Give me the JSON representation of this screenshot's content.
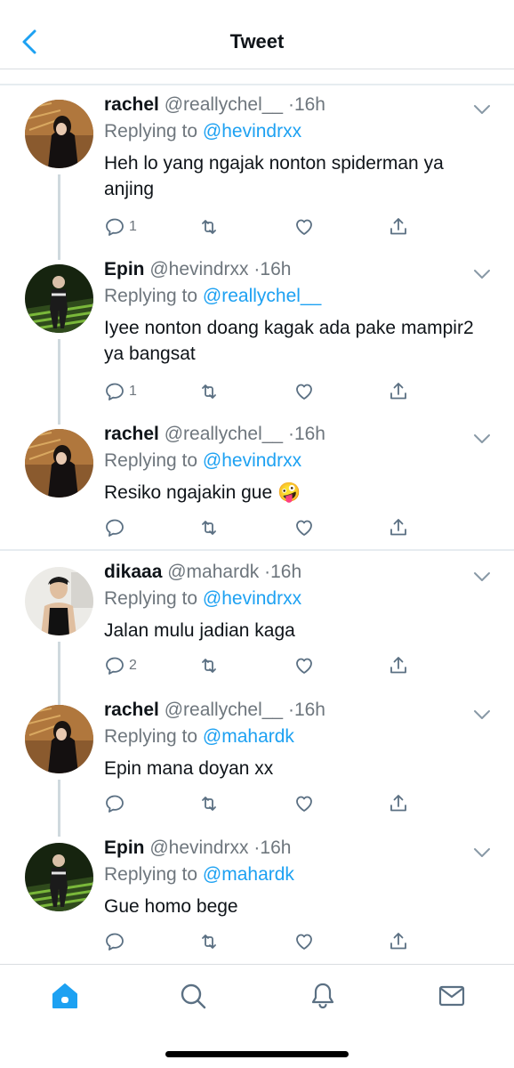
{
  "header": {
    "title": "Tweet"
  },
  "tweets": [
    {
      "name": "rachel",
      "handle": "@reallychel__",
      "dot": "·",
      "time": "16h",
      "replying_label": "Replying to",
      "replying_to": "@hevindrxx",
      "text": "Heh lo yang ngajak nonton spiderman ya anjing",
      "reply_count": "1",
      "avatar": "rachel"
    },
    {
      "name": "Epin",
      "handle": "@hevindrxx",
      "dot": "·",
      "time": "16h",
      "replying_label": "Replying to",
      "replying_to": "@reallychel__",
      "text": "Iyee nonton doang kagak ada pake mampir2 ya bangsat",
      "reply_count": "1",
      "avatar": "epin"
    },
    {
      "name": "rachel",
      "handle": "@reallychel__",
      "dot": "·",
      "time": "16h",
      "replying_label": "Replying to",
      "replying_to": "@hevindrxx",
      "text": "Resiko ngajakin gue 🤪",
      "reply_count": "",
      "avatar": "rachel"
    },
    {
      "name": "dikaaa",
      "handle": "@mahardk",
      "dot": "·",
      "time": "16h",
      "replying_label": "Replying to",
      "replying_to": "@hevindrxx",
      "text": "Jalan mulu jadian kaga",
      "reply_count": "2",
      "avatar": "dikaaa"
    },
    {
      "name": "rachel",
      "handle": "@reallychel__",
      "dot": "·",
      "time": "16h",
      "replying_label": "Replying to",
      "replying_to": "@mahardk",
      "text": "Epin mana doyan xx",
      "reply_count": "",
      "avatar": "rachel"
    },
    {
      "name": "Epin",
      "handle": "@hevindrxx",
      "dot": "·",
      "time": "16h",
      "replying_label": "Replying to",
      "replying_to": "@mahardk",
      "text": "Gue homo bege",
      "reply_count": "",
      "avatar": "epin"
    }
  ],
  "tabbar": {
    "items": [
      "home-icon",
      "search-icon",
      "notifications-icon",
      "messages-icon"
    ],
    "active": "home-icon"
  },
  "colors": {
    "accent": "#1da1f2",
    "secondary_text": "#6e767d",
    "primary_text": "#0f1419"
  }
}
